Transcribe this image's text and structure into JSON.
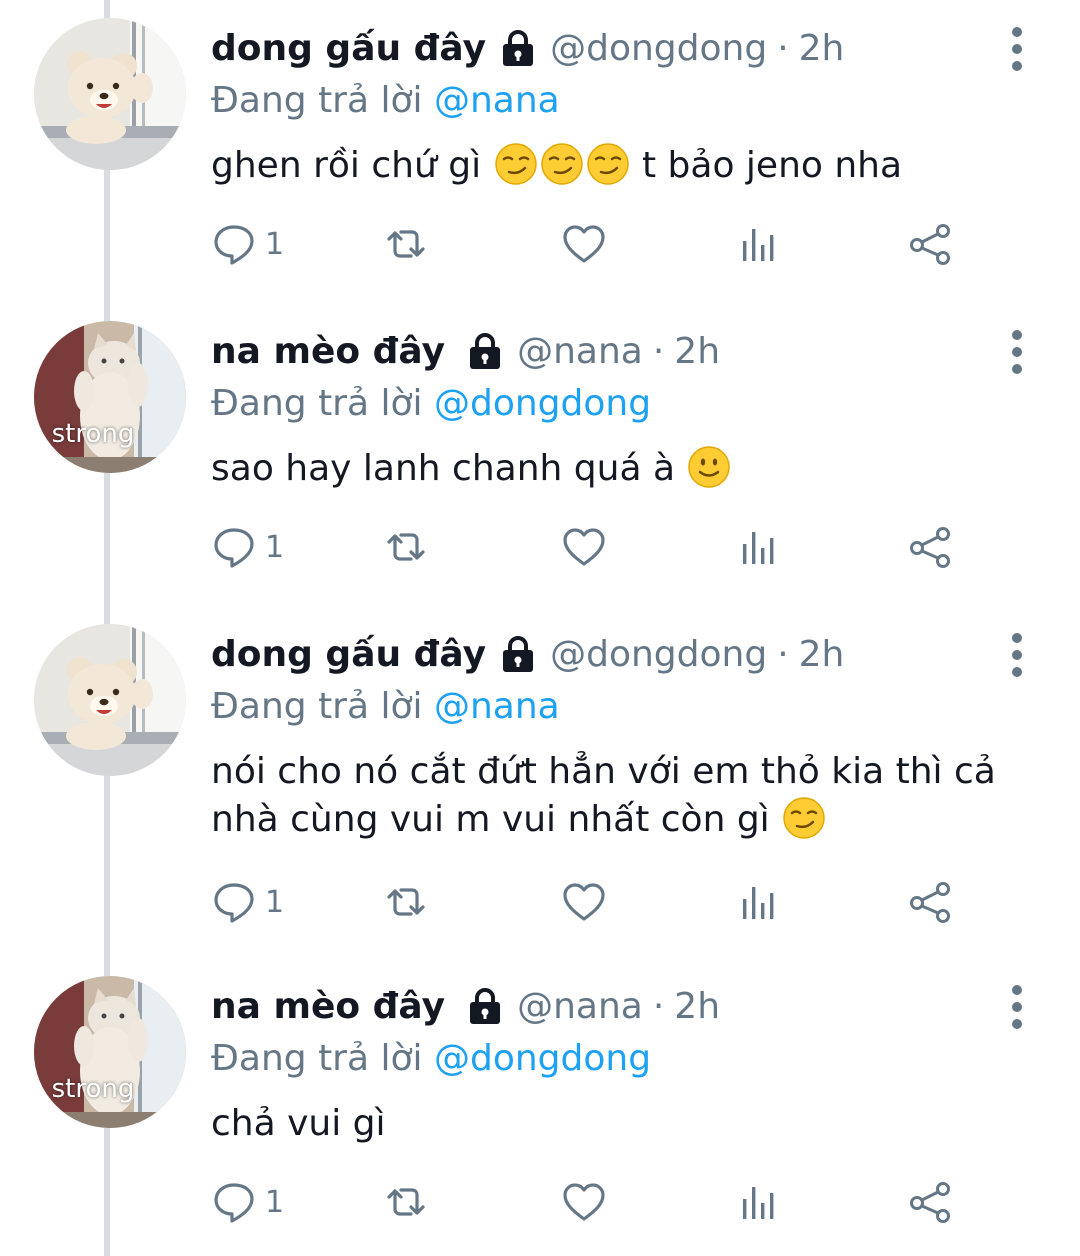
{
  "tweets": [
    {
      "name": "dong gấu đây",
      "handle": "@dongdong",
      "sep": "·",
      "time": "2h",
      "reply_prefix": "Đang trả lời",
      "reply_to": "@nana",
      "text_parts": [
        "ghen rồi chứ gì",
        "t bảo jeno nha"
      ],
      "text_line2": "",
      "emojis": [
        "smirk-emoji",
        "smirk-emoji",
        "smirk-emoji"
      ],
      "reply_count": "1",
      "avatar": "teddy-bear-avatar",
      "avatar_caption": ""
    },
    {
      "name": "na mèo đây",
      "handle": "@nana",
      "sep": "·",
      "time": "2h",
      "reply_prefix": "Đang trả lời",
      "reply_to": "@dongdong",
      "text_parts": [
        "sao hay lanh chanh quá à",
        ""
      ],
      "text_line2": "",
      "emojis": [
        "slight-smile-emoji"
      ],
      "reply_count": "1",
      "avatar": "cat-avatar",
      "avatar_caption": "strong"
    },
    {
      "name": "dong gấu đây",
      "handle": "@dongdong",
      "sep": "·",
      "time": "2h",
      "reply_prefix": "Đang trả lời",
      "reply_to": "@nana",
      "text_parts": [
        "nói cho nó cắt đứt hẳn với em thỏ kia thì cả",
        ""
      ],
      "text_line2": "nhà cùng vui m vui nhất còn gì",
      "emojis": [
        "smirk-emoji"
      ],
      "reply_count": "1",
      "avatar": "teddy-bear-avatar",
      "avatar_caption": ""
    },
    {
      "name": "na mèo đây",
      "handle": "@nana",
      "sep": "·",
      "time": "2h",
      "reply_prefix": "Đang trả lời",
      "reply_to": "@dongdong",
      "text_parts": [
        "chả vui gì",
        ""
      ],
      "text_line2": "",
      "emojis": [],
      "reply_count": "1",
      "avatar": "cat-avatar",
      "avatar_caption": "strong"
    }
  ],
  "colors": {
    "link": "#1da1f2",
    "muted": "#657786",
    "text": "#141823",
    "thread_line": "#d7dde2"
  },
  "icons": [
    "lock-icon",
    "more-icon",
    "reply-icon",
    "retweet-icon",
    "like-icon",
    "stats-icon",
    "share-icon"
  ]
}
